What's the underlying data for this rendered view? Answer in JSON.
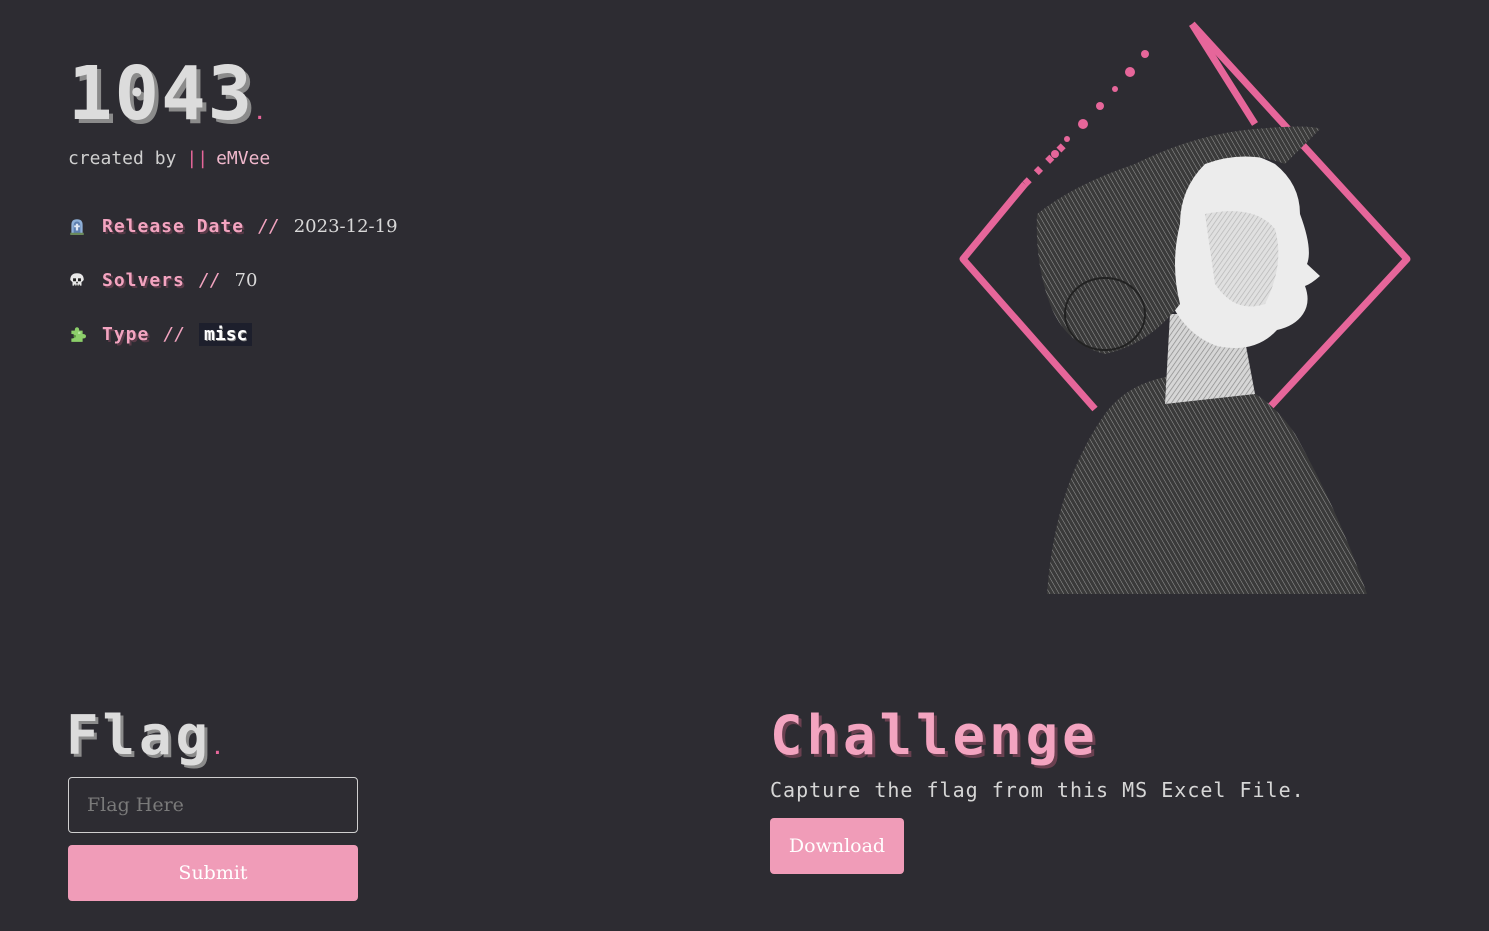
{
  "challenge": {
    "title": "1043",
    "title_dot": ".",
    "created_by_label": "created by",
    "separator": "||",
    "author": "eMVee"
  },
  "meta": {
    "release_label": "Release Date",
    "release_slash": "//",
    "release_value": "2023-12-19",
    "solvers_label": "Solvers",
    "solvers_slash": "//",
    "solvers_value": "70",
    "type_label": "Type",
    "type_slash": "//",
    "type_value": "misc"
  },
  "flag_section": {
    "heading": "Flag",
    "heading_dot": ".",
    "input_placeholder": "Flag Here",
    "submit_label": "Submit"
  },
  "challenge_section": {
    "heading": "Challenge",
    "description": "Capture the flag from this MS Excel File.",
    "download_label": "Download"
  },
  "colors": {
    "background": "#2d2c32",
    "accent_pink": "#e6669a",
    "button_pink": "#f09cb8"
  },
  "icons": [
    "tombstone-icon",
    "skull-icon",
    "puzzle-icon"
  ]
}
